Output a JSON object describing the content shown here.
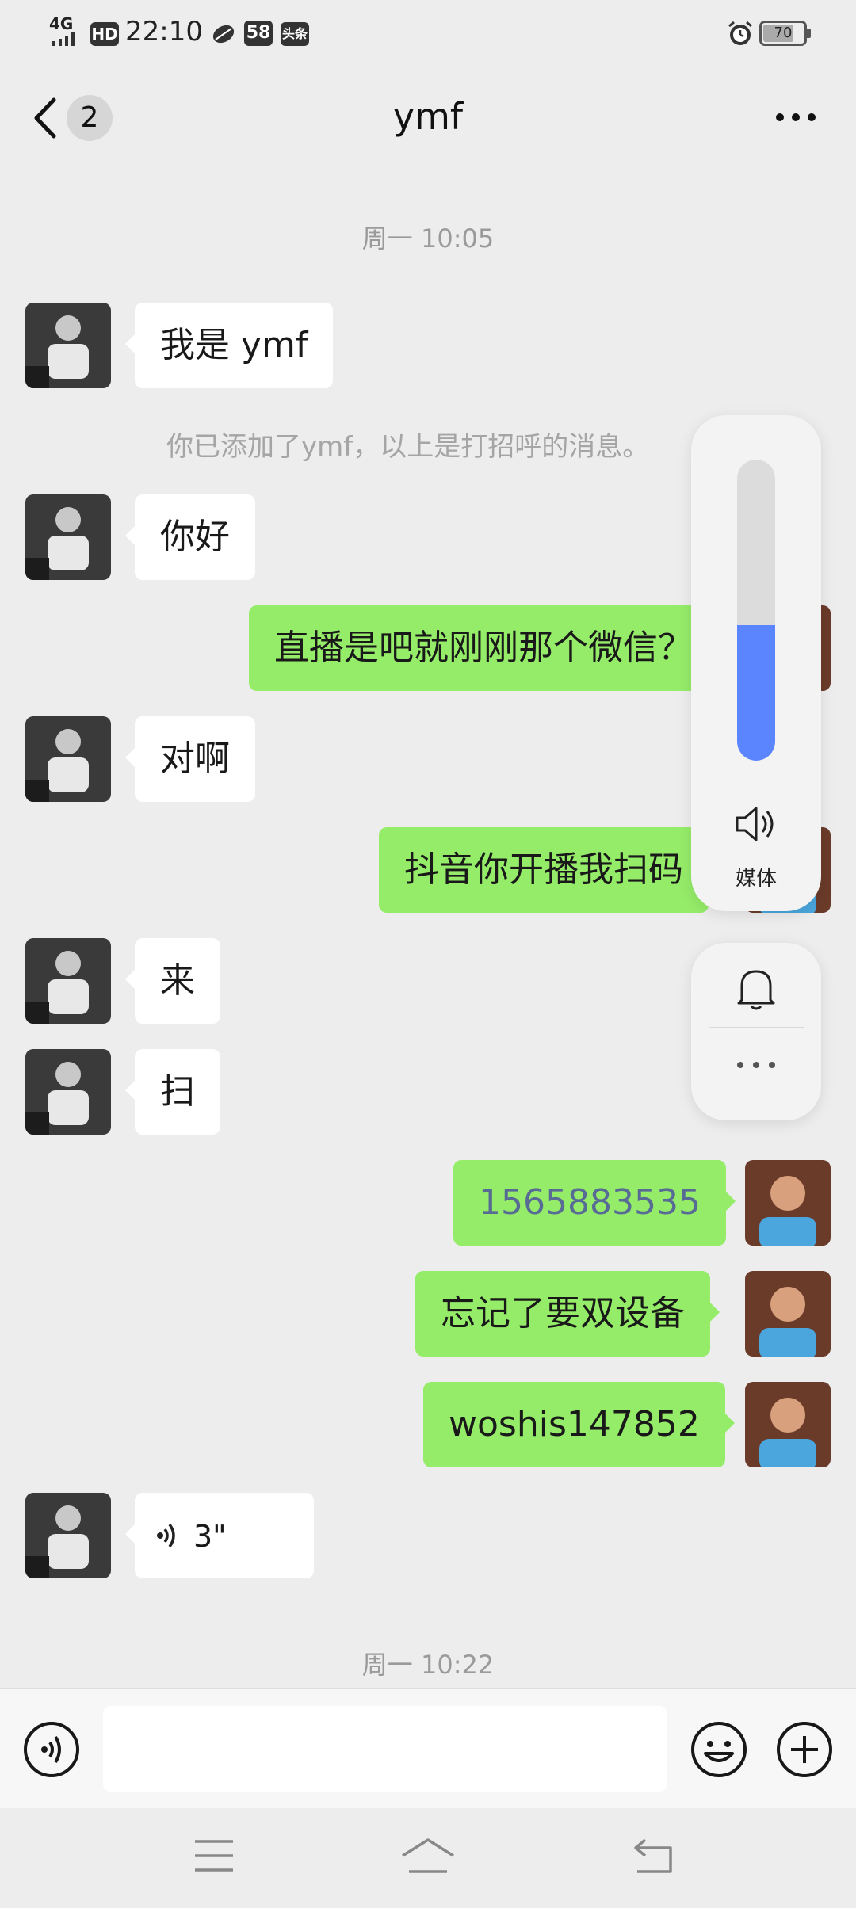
{
  "status_bar": {
    "signal": "4G",
    "hd": "HD",
    "time": "22:10",
    "app_badge": "58",
    "news_badge": "头条",
    "battery": "70"
  },
  "nav": {
    "unread_count": "2",
    "title": "ymf"
  },
  "chat": {
    "timestamp_1": "周一 10:05",
    "system_notice": "你已添加了ymf，以上是打招呼的消息。",
    "messages": [
      {
        "side": "left",
        "text": "我是 ymf"
      },
      {
        "side": "left",
        "text": "你好"
      },
      {
        "side": "right",
        "text": "直播是吧就刚刚那个微信？"
      },
      {
        "side": "left",
        "text": "对啊"
      },
      {
        "side": "right",
        "text": "抖音你开播我扫码"
      },
      {
        "side": "left",
        "text": "来"
      },
      {
        "side": "left",
        "text": "扫"
      },
      {
        "side": "right",
        "text": "1565883535"
      },
      {
        "side": "right",
        "text": "忘记了要双设备"
      },
      {
        "side": "right",
        "text": "woshis147852"
      },
      {
        "side": "left",
        "text": "3\""
      }
    ],
    "timestamp_2": "周一 10:22"
  },
  "volume_overlay": {
    "level": 0.45,
    "label": "媒体",
    "accent": "#5b84ff"
  },
  "icons": {
    "back": "chevron-left-icon",
    "more": "more-dots-icon",
    "voice": "voice-icon",
    "emoji": "emoji-icon",
    "plus": "plus-icon",
    "speaker": "speaker-icon",
    "bell": "bell-icon"
  },
  "colors": {
    "sent_bubble": "#95ec69",
    "received_bubble": "#ffffff",
    "background": "#ededed",
    "link_number": "#576b95"
  }
}
